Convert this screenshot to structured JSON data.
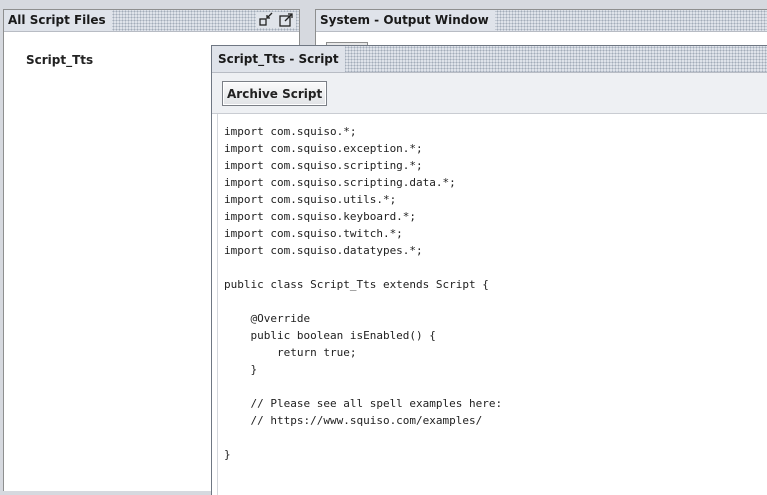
{
  "left_panel": {
    "title": "All Script Files",
    "icons": [
      "restore-icon",
      "popout-icon"
    ],
    "files": [
      "Script_Tts"
    ]
  },
  "output_window": {
    "title": "System - Output Window"
  },
  "script_window": {
    "title": "Script_Tts - Script",
    "toolbar": {
      "archive_label": "Archive Script"
    },
    "code_lines": [
      "import com.squiso.*;",
      "import com.squiso.exception.*;",
      "import com.squiso.scripting.*;",
      "import com.squiso.scripting.data.*;",
      "import com.squiso.utils.*;",
      "import com.squiso.keyboard.*;",
      "import com.squiso.twitch.*;",
      "import com.squiso.datatypes.*;",
      "",
      "public class Script_Tts extends Script {",
      "",
      "    @Override",
      "    public boolean isEnabled() {",
      "        return true;",
      "    }",
      "",
      "    // Please see all spell examples here:",
      "    // https://www.squiso.com/examples/",
      "",
      "}"
    ]
  }
}
